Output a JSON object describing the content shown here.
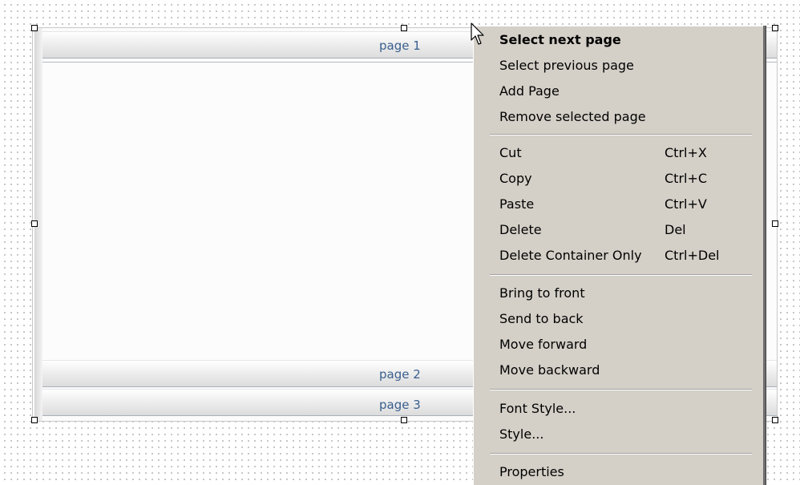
{
  "container": {
    "pages": [
      {
        "label": "page 1"
      },
      {
        "label": "page 2"
      },
      {
        "label": "page 3"
      }
    ]
  },
  "context_menu": {
    "groups": [
      [
        {
          "label": "Select next page",
          "shortcut": "",
          "bold": true
        },
        {
          "label": "Select previous page",
          "shortcut": ""
        },
        {
          "label": "Add Page",
          "shortcut": ""
        },
        {
          "label": "Remove selected page",
          "shortcut": ""
        }
      ],
      [
        {
          "label": "Cut",
          "shortcut": "Ctrl+X"
        },
        {
          "label": "Copy",
          "shortcut": "Ctrl+C"
        },
        {
          "label": "Paste",
          "shortcut": "Ctrl+V"
        },
        {
          "label": "Delete",
          "shortcut": "Del"
        },
        {
          "label": "Delete Container Only",
          "shortcut": "Ctrl+Del"
        }
      ],
      [
        {
          "label": "Bring to front",
          "shortcut": ""
        },
        {
          "label": "Send to back",
          "shortcut": ""
        },
        {
          "label": "Move forward",
          "shortcut": ""
        },
        {
          "label": "Move backward",
          "shortcut": ""
        }
      ],
      [
        {
          "label": "Font Style...",
          "shortcut": ""
        },
        {
          "label": "Style...",
          "shortcut": ""
        }
      ],
      [
        {
          "label": "Properties",
          "shortcut": ""
        }
      ]
    ]
  },
  "colors": {
    "menu_background": "#d4d0c8",
    "page_label": "#3a5f8f",
    "canvas_dots": "#b9b9b9"
  },
  "icons": {
    "cursor": "arrow-pointer-icon",
    "handle": "selection-handle"
  }
}
